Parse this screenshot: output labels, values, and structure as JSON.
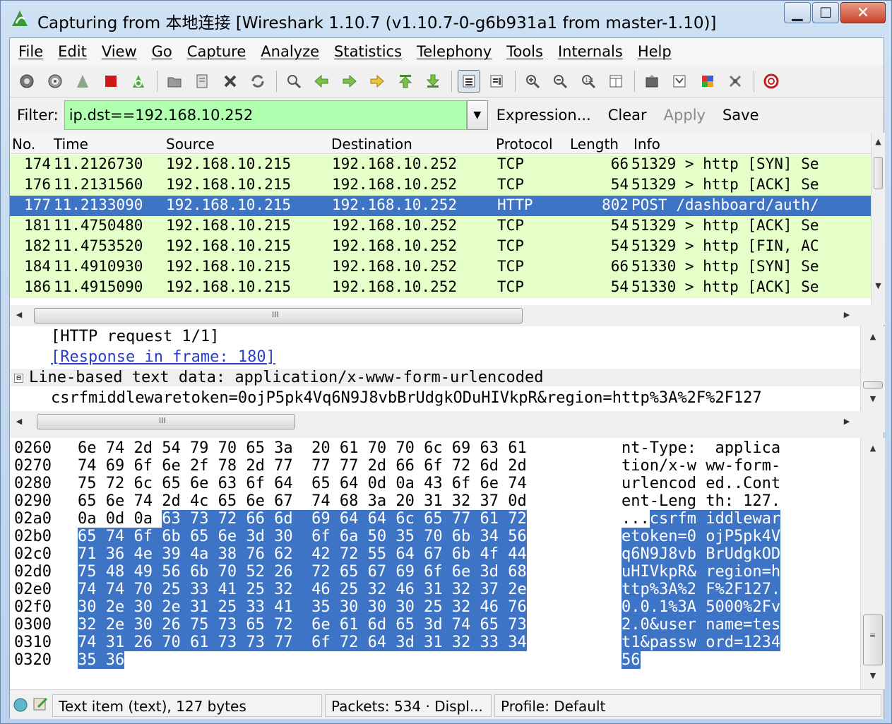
{
  "window": {
    "title": "Capturing from 本地连接   [Wireshark 1.10.7  (v1.10.7-0-g6b931a1 from master-1.10)]",
    "buttons": {
      "minimize": "▁",
      "maximize": "☐",
      "close": "✕"
    }
  },
  "menu": [
    "File",
    "Edit",
    "View",
    "Go",
    "Capture",
    "Analyze",
    "Statistics",
    "Telephony",
    "Tools",
    "Internals",
    "Help"
  ],
  "toolbar_icons": [
    "interfaces-icon",
    "options-icon",
    "start-capture-icon",
    "stop-capture-icon",
    "restart-capture-icon",
    "sep",
    "open-file-icon",
    "save-file-icon",
    "close-file-icon",
    "reload-icon",
    "sep",
    "find-icon",
    "go-back-icon",
    "go-forward-icon",
    "go-to-packet-icon",
    "go-first-icon",
    "go-last-icon",
    "sep",
    "colorize-icon",
    "autoscroll-icon",
    "sep",
    "zoom-in-icon",
    "zoom-out-icon",
    "zoom-normal-icon",
    "resize-columns-icon",
    "sep",
    "capture-filters-icon",
    "display-filters-icon",
    "coloring-rules-icon",
    "preferences-icon",
    "sep",
    "help-icon"
  ],
  "filter": {
    "label": "Filter:",
    "value": "ip.dst==192.168.10.252",
    "bg_color": "#afffaf",
    "buttons": {
      "expression": "Expression...",
      "clear": "Clear",
      "apply": "Apply",
      "save": "Save"
    }
  },
  "packet_list": {
    "columns": [
      "No.",
      "Time",
      "Source",
      "Destination",
      "Protocol",
      "Length",
      "Info"
    ],
    "rows": [
      {
        "no": "174",
        "time": "11.2126730",
        "source": "192.168.10.215",
        "destination": "192.168.10.252",
        "protocol": "TCP",
        "length": "66",
        "info": "51329 > http [SYN] Se"
      },
      {
        "no": "176",
        "time": "11.2131560",
        "source": "192.168.10.215",
        "destination": "192.168.10.252",
        "protocol": "TCP",
        "length": "54",
        "info": "51329 > http [ACK] Se"
      },
      {
        "no": "177",
        "time": "11.2133090",
        "source": "192.168.10.215",
        "destination": "192.168.10.252",
        "protocol": "HTTP",
        "length": "802",
        "info": "POST /dashboard/auth/"
      },
      {
        "no": "181",
        "time": "11.4750480",
        "source": "192.168.10.215",
        "destination": "192.168.10.252",
        "protocol": "TCP",
        "length": "54",
        "info": "51329 > http [ACK] Se"
      },
      {
        "no": "182",
        "time": "11.4753520",
        "source": "192.168.10.215",
        "destination": "192.168.10.252",
        "protocol": "TCP",
        "length": "54",
        "info": "51329 > http [FIN, AC"
      },
      {
        "no": "184",
        "time": "11.4910930",
        "source": "192.168.10.215",
        "destination": "192.168.10.252",
        "protocol": "TCP",
        "length": "66",
        "info": "51330 > http [SYN] Se"
      },
      {
        "no": "186",
        "time": "11.4915090",
        "source": "192.168.10.215",
        "destination": "192.168.10.252",
        "protocol": "TCP",
        "length": "54",
        "info": "51330 > http [ACK] Se"
      }
    ],
    "selected_index": 2,
    "row_color": "#e4ffc7",
    "selected_color": "#3e74c6"
  },
  "details": {
    "lines": [
      {
        "text": "[HTTP request 1/1]",
        "kind": "plain"
      },
      {
        "text": "[Response in frame: 180]",
        "kind": "link"
      },
      {
        "text": "Line-based text data: application/x-www-form-urlencoded",
        "kind": "expanded"
      },
      {
        "text": "csrfmiddlewaretoken=0ojP5pk4Vq6N9J8vbBrUdgkODuHIVkpR&region=http%3A%2F%2F127",
        "kind": "plain"
      }
    ],
    "expander": "⊟"
  },
  "bytes": {
    "rows": [
      {
        "offset": "0260",
        "hex_plain": "6e 74 2d 54 79 70 65 3a  20 61 70 70 6c 69 63 61",
        "hex_hl": "",
        "hex_hl2": "",
        "ascii_plain": "nt-Type:  applica",
        "ascii_hl": ""
      },
      {
        "offset": "0270",
        "hex_plain": "74 69 6f 6e 2f 78 2d 77  77 77 2d 66 6f 72 6d 2d",
        "hex_hl": "",
        "hex_hl2": "",
        "ascii_plain": "tion/x-w ww-form-",
        "ascii_hl": ""
      },
      {
        "offset": "0280",
        "hex_plain": "75 72 6c 65 6e 63 6f 64  65 64 0d 0a 43 6f 6e 74",
        "hex_hl": "",
        "hex_hl2": "",
        "ascii_plain": "urlencod ed..Cont",
        "ascii_hl": ""
      },
      {
        "offset": "0290",
        "hex_plain": "65 6e 74 2d 4c 65 6e 67  74 68 3a 20 31 32 37 0d",
        "hex_hl": "",
        "hex_hl2": "",
        "ascii_plain": "ent-Leng th: 127.",
        "ascii_hl": ""
      },
      {
        "offset": "02a0",
        "hex_plain": "0a 0d 0a ",
        "hex_hl": "63 73 72 66 6d  69 64 64 6c 65 77 61 72",
        "hex_hl2": "",
        "ascii_plain": "...",
        "ascii_hl": "csrfm iddlewar"
      },
      {
        "offset": "02b0",
        "hex_plain": "",
        "hex_hl": "65 74 6f 6b 65 6e 3d 30  6f 6a 50 35 70 6b 34 56",
        "hex_hl2": "",
        "ascii_plain": "",
        "ascii_hl": "etoken=0 ojP5pk4V"
      },
      {
        "offset": "02c0",
        "hex_plain": "",
        "hex_hl": "71 36 4e 39 4a 38 76 62  42 72 55 64 67 6b 4f 44",
        "hex_hl2": "",
        "ascii_plain": "",
        "ascii_hl": "q6N9J8vb BrUdgkOD"
      },
      {
        "offset": "02d0",
        "hex_plain": "",
        "hex_hl": "75 48 49 56 6b 70 52 26  72 65 67 69 6f 6e 3d 68",
        "hex_hl2": "",
        "ascii_plain": "",
        "ascii_hl": "uHIVkpR& region=h"
      },
      {
        "offset": "02e0",
        "hex_plain": "",
        "hex_hl": "74 74 70 25 33 41 25 32  46 25 32 46 31 32 37 2e",
        "hex_hl2": "",
        "ascii_plain": "",
        "ascii_hl": "ttp%3A%2 F%2F127."
      },
      {
        "offset": "02f0",
        "hex_plain": "",
        "hex_hl": "30 2e 30 2e 31 25 33 41  35 30 30 30 25 32 46 76",
        "hex_hl2": "",
        "ascii_plain": "",
        "ascii_hl": "0.0.1%3A 5000%2Fv"
      },
      {
        "offset": "0300",
        "hex_plain": "",
        "hex_hl": "32 2e 30 26 75 73 65 72  6e 61 6d 65 3d 74 65 73",
        "hex_hl2": "",
        "ascii_plain": "",
        "ascii_hl": "2.0&user name=tes"
      },
      {
        "offset": "0310",
        "hex_plain": "",
        "hex_hl": "74 31 26 70 61 73 73 77  6f 72 64 3d 31 32 33 34",
        "hex_hl2": "",
        "ascii_plain": "",
        "ascii_hl": "t1&passw ord=1234"
      },
      {
        "offset": "0320",
        "hex_plain": "",
        "hex_hl": "35 36",
        "hex_hl2": "",
        "ascii_plain": "",
        "ascii_hl": "56"
      }
    ]
  },
  "statusbar": {
    "item": "Text item (text), 127 bytes",
    "packets": "Packets: 534 · Displ...",
    "profile": "Profile: Default"
  }
}
